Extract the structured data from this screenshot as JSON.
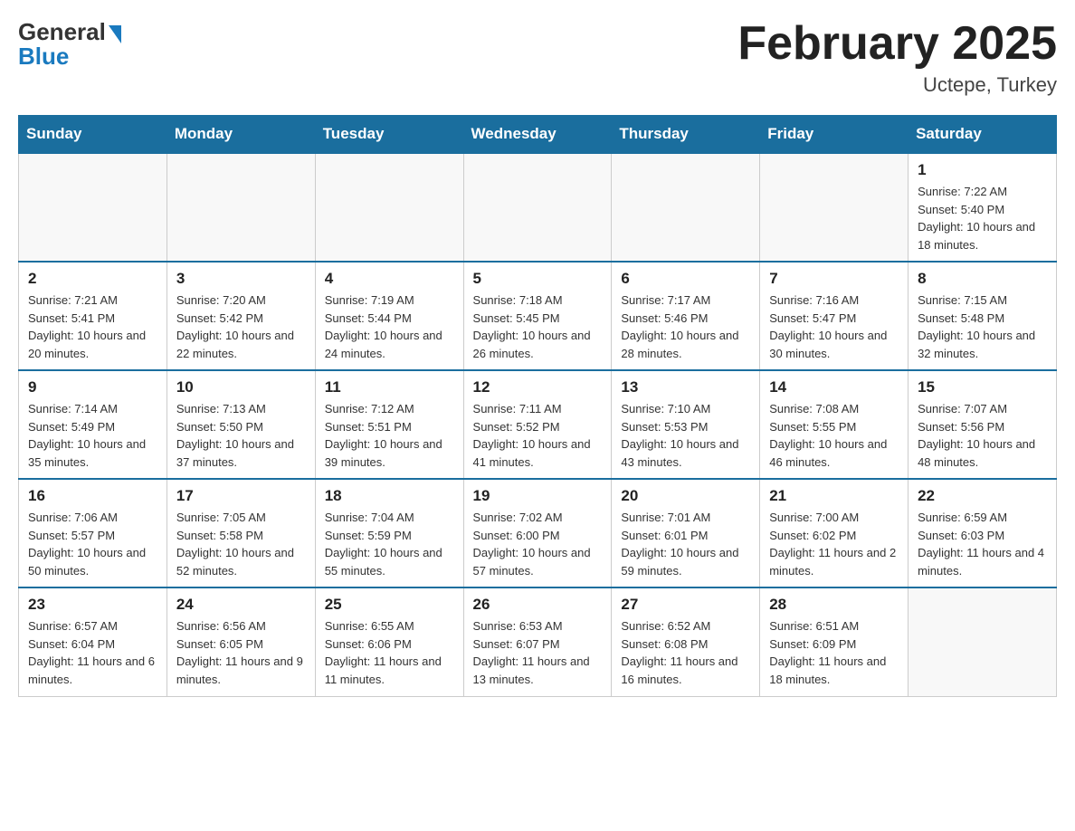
{
  "header": {
    "logo": {
      "general": "General",
      "blue": "Blue"
    },
    "title": "February 2025",
    "location": "Uctepe, Turkey"
  },
  "days_of_week": [
    "Sunday",
    "Monday",
    "Tuesday",
    "Wednesday",
    "Thursday",
    "Friday",
    "Saturday"
  ],
  "weeks": [
    [
      {
        "day": "",
        "info": ""
      },
      {
        "day": "",
        "info": ""
      },
      {
        "day": "",
        "info": ""
      },
      {
        "day": "",
        "info": ""
      },
      {
        "day": "",
        "info": ""
      },
      {
        "day": "",
        "info": ""
      },
      {
        "day": "1",
        "info": "Sunrise: 7:22 AM\nSunset: 5:40 PM\nDaylight: 10 hours and 18 minutes."
      }
    ],
    [
      {
        "day": "2",
        "info": "Sunrise: 7:21 AM\nSunset: 5:41 PM\nDaylight: 10 hours and 20 minutes."
      },
      {
        "day": "3",
        "info": "Sunrise: 7:20 AM\nSunset: 5:42 PM\nDaylight: 10 hours and 22 minutes."
      },
      {
        "day": "4",
        "info": "Sunrise: 7:19 AM\nSunset: 5:44 PM\nDaylight: 10 hours and 24 minutes."
      },
      {
        "day": "5",
        "info": "Sunrise: 7:18 AM\nSunset: 5:45 PM\nDaylight: 10 hours and 26 minutes."
      },
      {
        "day": "6",
        "info": "Sunrise: 7:17 AM\nSunset: 5:46 PM\nDaylight: 10 hours and 28 minutes."
      },
      {
        "day": "7",
        "info": "Sunrise: 7:16 AM\nSunset: 5:47 PM\nDaylight: 10 hours and 30 minutes."
      },
      {
        "day": "8",
        "info": "Sunrise: 7:15 AM\nSunset: 5:48 PM\nDaylight: 10 hours and 32 minutes."
      }
    ],
    [
      {
        "day": "9",
        "info": "Sunrise: 7:14 AM\nSunset: 5:49 PM\nDaylight: 10 hours and 35 minutes."
      },
      {
        "day": "10",
        "info": "Sunrise: 7:13 AM\nSunset: 5:50 PM\nDaylight: 10 hours and 37 minutes."
      },
      {
        "day": "11",
        "info": "Sunrise: 7:12 AM\nSunset: 5:51 PM\nDaylight: 10 hours and 39 minutes."
      },
      {
        "day": "12",
        "info": "Sunrise: 7:11 AM\nSunset: 5:52 PM\nDaylight: 10 hours and 41 minutes."
      },
      {
        "day": "13",
        "info": "Sunrise: 7:10 AM\nSunset: 5:53 PM\nDaylight: 10 hours and 43 minutes."
      },
      {
        "day": "14",
        "info": "Sunrise: 7:08 AM\nSunset: 5:55 PM\nDaylight: 10 hours and 46 minutes."
      },
      {
        "day": "15",
        "info": "Sunrise: 7:07 AM\nSunset: 5:56 PM\nDaylight: 10 hours and 48 minutes."
      }
    ],
    [
      {
        "day": "16",
        "info": "Sunrise: 7:06 AM\nSunset: 5:57 PM\nDaylight: 10 hours and 50 minutes."
      },
      {
        "day": "17",
        "info": "Sunrise: 7:05 AM\nSunset: 5:58 PM\nDaylight: 10 hours and 52 minutes."
      },
      {
        "day": "18",
        "info": "Sunrise: 7:04 AM\nSunset: 5:59 PM\nDaylight: 10 hours and 55 minutes."
      },
      {
        "day": "19",
        "info": "Sunrise: 7:02 AM\nSunset: 6:00 PM\nDaylight: 10 hours and 57 minutes."
      },
      {
        "day": "20",
        "info": "Sunrise: 7:01 AM\nSunset: 6:01 PM\nDaylight: 10 hours and 59 minutes."
      },
      {
        "day": "21",
        "info": "Sunrise: 7:00 AM\nSunset: 6:02 PM\nDaylight: 11 hours and 2 minutes."
      },
      {
        "day": "22",
        "info": "Sunrise: 6:59 AM\nSunset: 6:03 PM\nDaylight: 11 hours and 4 minutes."
      }
    ],
    [
      {
        "day": "23",
        "info": "Sunrise: 6:57 AM\nSunset: 6:04 PM\nDaylight: 11 hours and 6 minutes."
      },
      {
        "day": "24",
        "info": "Sunrise: 6:56 AM\nSunset: 6:05 PM\nDaylight: 11 hours and 9 minutes."
      },
      {
        "day": "25",
        "info": "Sunrise: 6:55 AM\nSunset: 6:06 PM\nDaylight: 11 hours and 11 minutes."
      },
      {
        "day": "26",
        "info": "Sunrise: 6:53 AM\nSunset: 6:07 PM\nDaylight: 11 hours and 13 minutes."
      },
      {
        "day": "27",
        "info": "Sunrise: 6:52 AM\nSunset: 6:08 PM\nDaylight: 11 hours and 16 minutes."
      },
      {
        "day": "28",
        "info": "Sunrise: 6:51 AM\nSunset: 6:09 PM\nDaylight: 11 hours and 18 minutes."
      },
      {
        "day": "",
        "info": ""
      }
    ]
  ]
}
